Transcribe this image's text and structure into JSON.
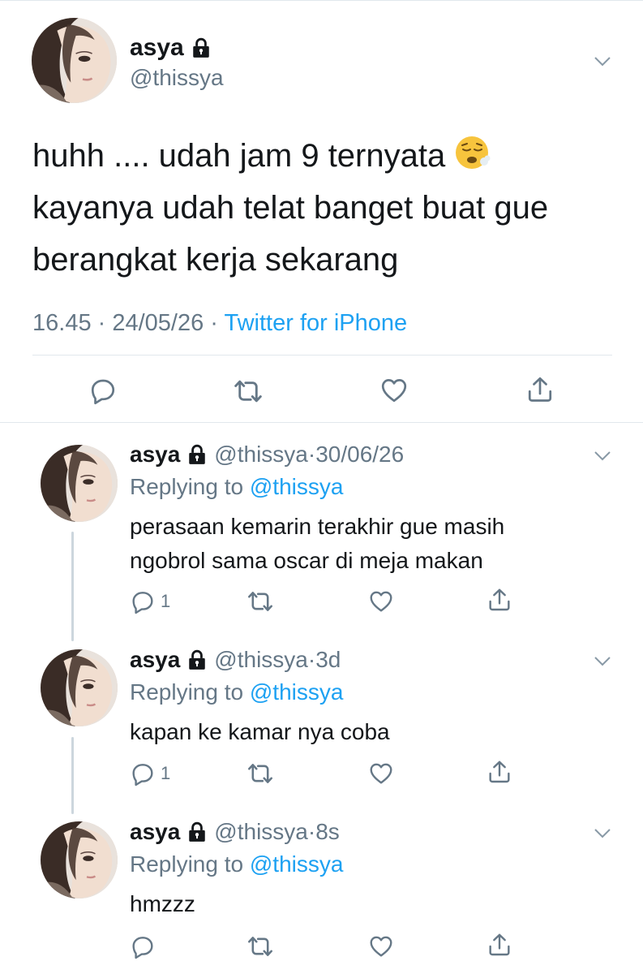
{
  "main_tweet": {
    "display_name": "asya",
    "handle": "@thissya",
    "text_line1": "huhh .... udah jam 9 ternyata",
    "text_line2": "kayanya udah telat banget buat gue",
    "text_line3": "berangkat kerja sekarang",
    "time": "16.45 · 24/05/26 · ",
    "source": "Twitter for iPhone"
  },
  "replies": [
    {
      "display_name": "asya",
      "handle": "@thissya",
      "dot": "·",
      "time": "30/06/26",
      "replying_prefix": "Replying to ",
      "replying_to": "@thissya",
      "text_line1": "perasaan kemarin terakhir gue masih",
      "text_line2": "ngobrol sama oscar di meja makan",
      "reply_count": "1"
    },
    {
      "display_name": "asya",
      "handle": "@thissya",
      "dot": "·",
      "time": "3d",
      "replying_prefix": "Replying to ",
      "replying_to": "@thissya",
      "text_line1": "kapan ke kamar nya coba",
      "text_line2": "",
      "reply_count": "1"
    },
    {
      "display_name": "asya",
      "handle": "@thissya",
      "dot": "·",
      "time": "8s",
      "replying_prefix": "Replying to ",
      "replying_to": "@thissya",
      "text_line1": "hmzzz",
      "text_line2": "",
      "reply_count": ""
    }
  ],
  "icons": {
    "lock": "lock-icon",
    "chevron": "chevron-down-icon",
    "reply": "reply-icon",
    "retweet": "retweet-icon",
    "like": "heart-icon",
    "share": "share-icon",
    "emoji": "exhausted-face-emoji"
  },
  "colors": {
    "text": "#14171a",
    "secondary": "#657786",
    "link": "#1da1f2",
    "divider": "#e1e8ed",
    "thread_line": "#ccd6dd"
  }
}
